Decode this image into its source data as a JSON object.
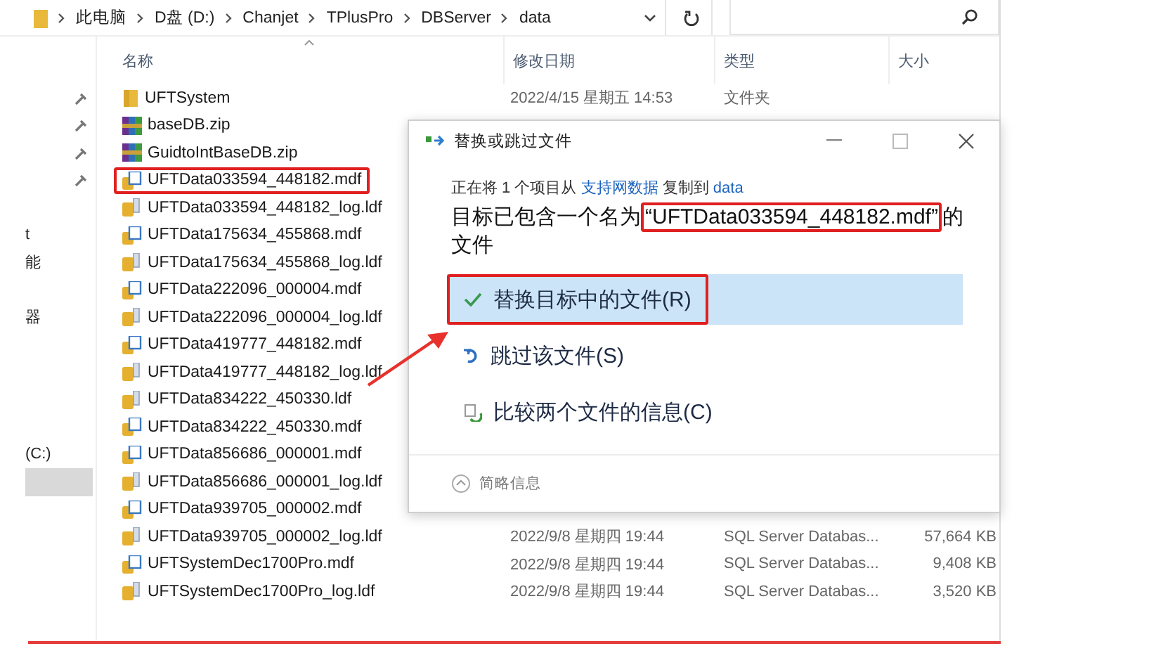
{
  "address_bar": {
    "path": [
      "此电脑",
      "D盘 (D:)",
      "Chanjet",
      "TPlusPro",
      "DBServer",
      "data"
    ]
  },
  "nav_pane": [
    {
      "label": "t",
      "selected": false
    },
    {
      "label": "能",
      "selected": false
    },
    {
      "label": "器",
      "selected": false
    },
    {
      "label": "(C:)",
      "selected": false
    },
    {
      "selected": true
    }
  ],
  "columns": [
    "名称",
    "修改日期",
    "类型",
    "大小"
  ],
  "files": [
    {
      "kind": "folder",
      "name": "UFTSystem",
      "date": "2022/4/15 星期五 14:53",
      "type": "文件夹",
      "annotated": false
    },
    {
      "kind": "zip",
      "name": "baseDB.zip",
      "annotated": false
    },
    {
      "kind": "zip",
      "name": "GuidtoIntBaseDB.zip",
      "annotated": false
    },
    {
      "kind": "mdf",
      "name": "UFTData033594_448182.mdf",
      "annotated": true
    },
    {
      "kind": "ldf",
      "name": "UFTData033594_448182_log.ldf",
      "annotated": false
    },
    {
      "kind": "mdf",
      "name": "UFTData175634_455868.mdf",
      "annotated": false
    },
    {
      "kind": "ldf",
      "name": "UFTData175634_455868_log.ldf",
      "annotated": false
    },
    {
      "kind": "mdf",
      "name": "UFTData222096_000004.mdf",
      "annotated": false
    },
    {
      "kind": "ldf",
      "name": "UFTData222096_000004_log.ldf",
      "annotated": false
    },
    {
      "kind": "mdf",
      "name": "UFTData419777_448182.mdf",
      "annotated": false
    },
    {
      "kind": "ldf",
      "name": "UFTData419777_448182_log.ldf",
      "annotated": false
    },
    {
      "kind": "ldf",
      "name": "UFTData834222_450330.ldf",
      "annotated": false
    },
    {
      "kind": "mdf",
      "name": "UFTData834222_450330.mdf",
      "annotated": false
    },
    {
      "kind": "mdf",
      "name": "UFTData856686_000001.mdf",
      "annotated": false
    },
    {
      "kind": "ldf",
      "name": "UFTData856686_000001_log.ldf",
      "annotated": false
    },
    {
      "kind": "mdf",
      "name": "UFTData939705_000002.mdf",
      "annotated": false
    },
    {
      "kind": "ldf",
      "name": "UFTData939705_000002_log.ldf",
      "date": "2022/9/8 星期四 19:44",
      "type": "SQL Server Databas...",
      "size": "57,664 KB",
      "annotated": false
    },
    {
      "kind": "mdf",
      "name": "UFTSystemDec1700Pro.mdf",
      "date": "2022/9/8 星期四 19:44",
      "type": "SQL Server Databas...",
      "size": "9,408 KB",
      "annotated": false
    },
    {
      "kind": "ldf",
      "name": "UFTSystemDec1700Pro_log.ldf",
      "date": "2022/9/8 星期四 19:44",
      "type": "SQL Server Databas...",
      "size": "3,520 KB",
      "annotated": false
    }
  ],
  "dialog": {
    "title": "替换或跳过文件",
    "copy_line": [
      {
        "text": "正在将 1 个项目从 ",
        "link": false
      },
      {
        "text": "支持网数据",
        "link": true
      },
      {
        "text": " 复制到 ",
        "link": false
      },
      {
        "text": "data",
        "link": true
      }
    ],
    "message": [
      {
        "text": "目标已包含一个名为",
        "annotated": false
      },
      {
        "text": "“UFTData033594_448182.mdf”",
        "annotated": true
      },
      {
        "text": "的文件",
        "annotated": false
      }
    ],
    "options": [
      {
        "kind": "replace",
        "label": "替换目标中的文件(R)",
        "selected": true,
        "annotated": true
      },
      {
        "kind": "skip",
        "label": "跳过该文件(S)",
        "selected": false,
        "annotated": false
      },
      {
        "kind": "compare",
        "label": "比较两个文件的信息(C)",
        "selected": false,
        "annotated": false
      }
    ],
    "details_toggle": "简略信息"
  }
}
